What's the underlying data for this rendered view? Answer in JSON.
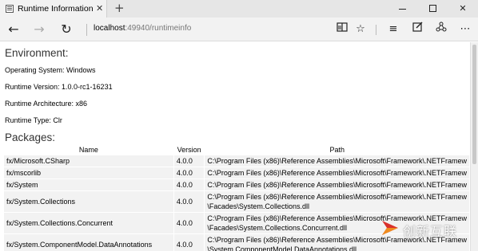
{
  "tab": {
    "title": "Runtime Information",
    "close_glyph": "✕",
    "new_tab_glyph": "+"
  },
  "window": {
    "close_glyph": "✕"
  },
  "toolbar": {
    "back_glyph": "←",
    "forward_glyph": "→",
    "refresh_glyph": "↻",
    "address_host": "localhost",
    "address_rest": ":49940/runtimeinfo",
    "reading_glyph": "📖",
    "favorite_glyph": "☆",
    "hub_glyph": "≡",
    "note_glyph": "✎",
    "share_glyph": "⚇",
    "more_glyph": "⋯",
    "icons": [
      "reading-view-icon",
      "favorite-star-icon",
      "hub-icon",
      "web-note-icon",
      "share-icon",
      "more-icon"
    ]
  },
  "environment": {
    "heading": "Environment:",
    "os": "Operating System: Windows",
    "version": "Runtime Version: 1.0.0-rc1-16231",
    "architecture": "Runtime Architecture: x86",
    "type": "Runtime Type: Clr"
  },
  "packages": {
    "heading": "Packages:",
    "columns": [
      "Name",
      "Version",
      "Path"
    ],
    "rows": [
      {
        "name": "fx/Microsoft.CSharp",
        "version": "4.0.0",
        "path1": "C:\\Program Files (x86)\\Reference Assemblies\\Microsoft\\Framework\\.NETFramew",
        "path2": ""
      },
      {
        "name": "fx/mscorlib",
        "version": "4.0.0",
        "path1": "C:\\Program Files (x86)\\Reference Assemblies\\Microsoft\\Framework\\.NETFramew",
        "path2": ""
      },
      {
        "name": "fx/System",
        "version": "4.0.0",
        "path1": "C:\\Program Files (x86)\\Reference Assemblies\\Microsoft\\Framework\\.NETFramew",
        "path2": ""
      },
      {
        "name": "fx/System.Collections",
        "version": "4.0.0",
        "path1": "C:\\Program Files (x86)\\Reference Assemblies\\Microsoft\\Framework\\.NETFramew",
        "path2": "\\Facades\\System.Collections.dll"
      },
      {
        "name": "fx/System.Collections.Concurrent",
        "version": "4.0.0",
        "path1": "C:\\Program Files (x86)\\Reference Assemblies\\Microsoft\\Framework\\.NETFramew",
        "path2": "\\Facades\\System.Collections.Concurrent.dll"
      },
      {
        "name": "fx/System.ComponentModel.DataAnnotations",
        "version": "4.0.0",
        "path1": "C:\\Program Files (x86)\\Reference Assemblies\\Microsoft\\Framework\\.NETFramew",
        "path2": "\\System.ComponentModel.DataAnnotations.dll"
      }
    ]
  },
  "watermark": {
    "text": "创新互联"
  },
  "colors": {
    "tab_bar": "#e6e6e6",
    "active_tab": "#f2f2f2",
    "cell_bg": "#f2f2f2",
    "watermark_red": "#d9302c",
    "watermark_orange": "#f08c1e"
  }
}
